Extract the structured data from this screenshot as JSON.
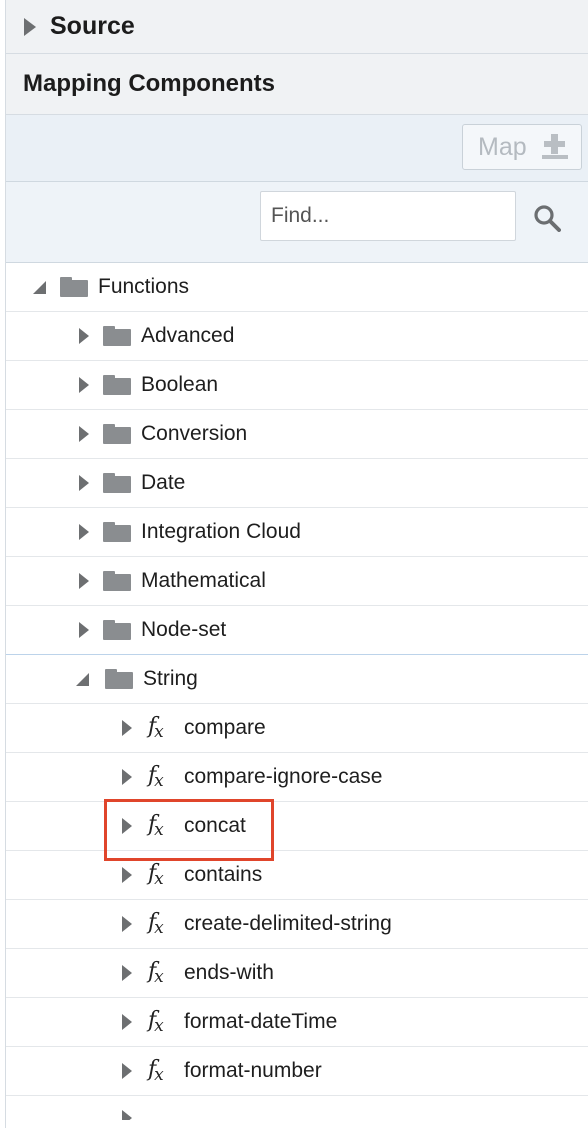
{
  "source": {
    "title": "Source"
  },
  "mapping_components": {
    "title": "Mapping Components"
  },
  "toolbar": {
    "map_label": "Map"
  },
  "search": {
    "placeholder": "Find..."
  },
  "tree": {
    "root": {
      "label": "Functions",
      "expanded": true
    },
    "folders": [
      {
        "label": "Advanced",
        "expanded": false
      },
      {
        "label": "Boolean",
        "expanded": false
      },
      {
        "label": "Conversion",
        "expanded": false
      },
      {
        "label": "Date",
        "expanded": false
      },
      {
        "label": "Integration Cloud",
        "expanded": false
      },
      {
        "label": "Mathematical",
        "expanded": false
      },
      {
        "label": "Node-set",
        "expanded": false
      },
      {
        "label": "String",
        "expanded": true
      }
    ],
    "string_functions": [
      {
        "label": "compare"
      },
      {
        "label": "compare-ignore-case"
      },
      {
        "label": "concat",
        "highlighted": true
      },
      {
        "label": "contains"
      },
      {
        "label": "create-delimited-string"
      },
      {
        "label": "ends-with"
      },
      {
        "label": "format-dateTime"
      },
      {
        "label": "format-number"
      }
    ]
  },
  "colors": {
    "highlight_border": "#e0452b",
    "header_bg": "#f0f2f4",
    "toolbar_bg": "#eaf0f6"
  }
}
